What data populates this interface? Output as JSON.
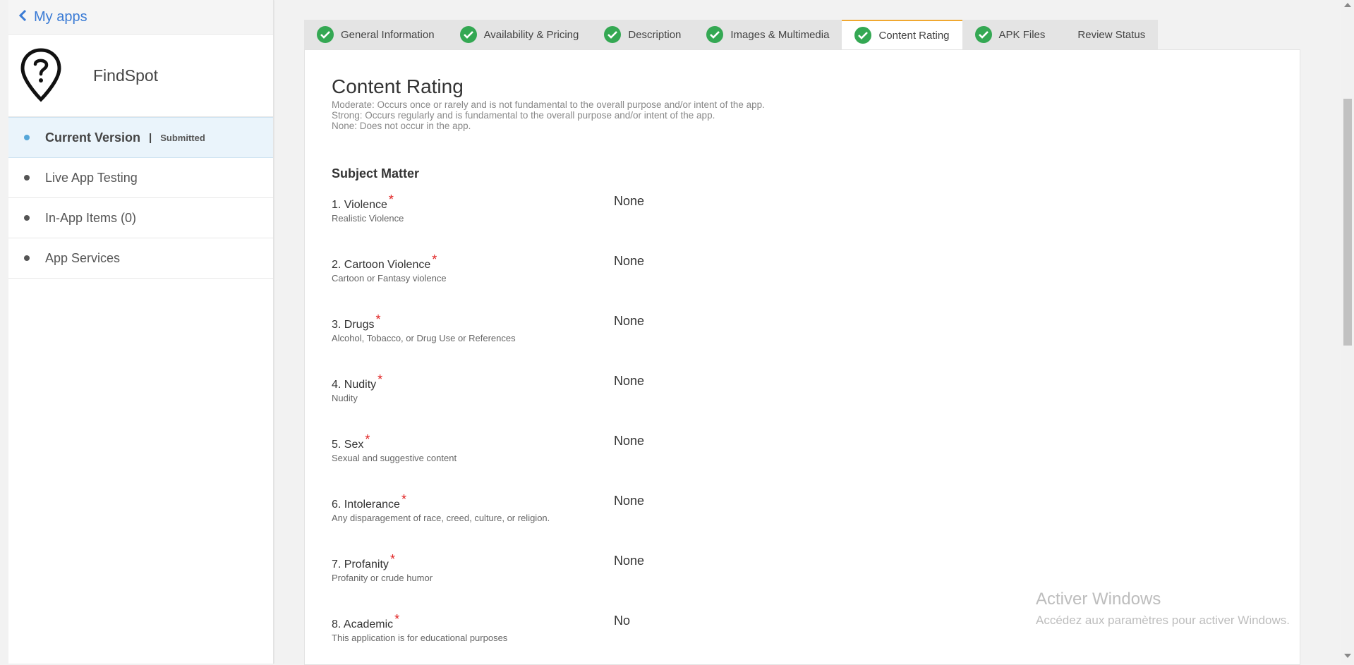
{
  "sidebar": {
    "back_label": "My apps",
    "app_name": "FindSpot",
    "app_icon": "location-question-icon",
    "items": [
      {
        "label": "Current Version",
        "separator": "|",
        "status": "Submitted"
      },
      {
        "label": "Live App Testing"
      },
      {
        "label": "In-App Items (0)"
      },
      {
        "label": "App Services"
      }
    ]
  },
  "tabs": [
    {
      "label": "General Information",
      "complete": true
    },
    {
      "label": "Availability & Pricing",
      "complete": true
    },
    {
      "label": "Description",
      "complete": true
    },
    {
      "label": "Images & Multimedia",
      "complete": true
    },
    {
      "label": "Content Rating",
      "complete": true,
      "active": true
    },
    {
      "label": "APK Files",
      "complete": true
    },
    {
      "label": "Review Status",
      "complete": false
    }
  ],
  "main": {
    "title": "Content Rating",
    "legend": [
      "Moderate: Occurs once or rarely and is not fundamental to the overall purpose and/or intent of the app.",
      "Strong: Occurs regularly and is fundamental to the overall purpose and/or intent of the app.",
      "None: Does not occur in the app."
    ],
    "section_title": "Subject Matter",
    "questions": [
      {
        "title": "1. Violence",
        "subtitle": "Realistic Violence",
        "answer": "None"
      },
      {
        "title": "2. Cartoon Violence",
        "subtitle": "Cartoon or Fantasy violence",
        "answer": "None"
      },
      {
        "title": "3. Drugs",
        "subtitle": "Alcohol, Tobacco, or Drug Use or References",
        "answer": "None"
      },
      {
        "title": "4. Nudity",
        "subtitle": "Nudity",
        "answer": "None"
      },
      {
        "title": "5. Sex",
        "subtitle": "Sexual and suggestive content",
        "answer": "None"
      },
      {
        "title": "6. Intolerance",
        "subtitle": "Any disparagement of race, creed, culture, or religion.",
        "answer": "None"
      },
      {
        "title": "7. Profanity",
        "subtitle": "Profanity or crude humor",
        "answer": "None"
      },
      {
        "title": "8. Academic",
        "subtitle": "This application is for educational purposes",
        "answer": "No"
      }
    ],
    "required_marker": "*"
  },
  "watermark": {
    "line1": "Activer Windows",
    "line2": "Accédez aux paramètres pour activer Windows."
  },
  "colors": {
    "link": "#3a7bd5",
    "check": "#34a853",
    "active_tab_border": "#f0a830",
    "required": "#e02020",
    "active_nav_bg": "#eaf4fb"
  }
}
